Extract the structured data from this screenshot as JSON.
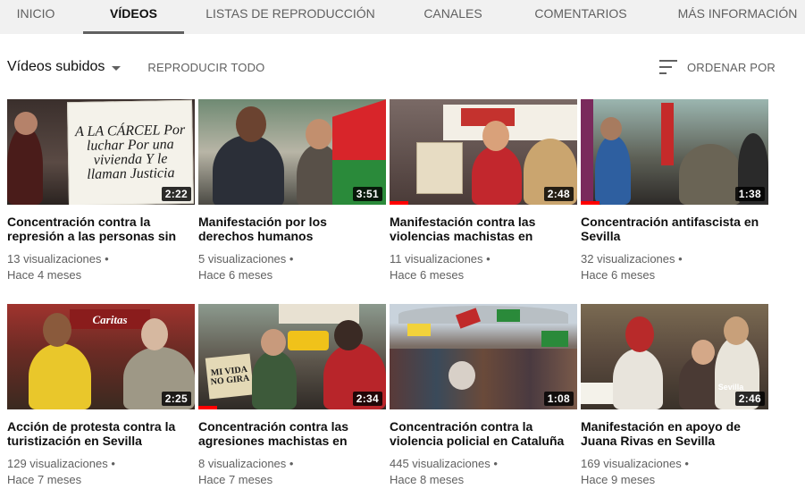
{
  "tabs": [
    {
      "label": "INICIO"
    },
    {
      "label": "VÍDEOS"
    },
    {
      "label": "LISTAS DE REPRODUCCIÓN"
    },
    {
      "label": "CANALES"
    },
    {
      "label": "COMENTARIOS"
    },
    {
      "label": "MÁS INFORMACIÓN"
    }
  ],
  "active_tab": "VÍDEOS",
  "toolbar": {
    "uploads_label": "Vídeos subidos",
    "play_all_label": "REPRODUCIR TODO",
    "sort_label": "ORDENAR POR"
  },
  "videos": [
    {
      "title": "Concentración contra la represión a las personas sin",
      "views": "13 visualizaciones",
      "age": "Hace 4 meses",
      "duration": "2:22",
      "sign_text": "A LA CÁRCEL Por luchar Por una vivienda Y le llaman Justicia",
      "watched": 0
    },
    {
      "title": "Manifestación por los derechos humanos",
      "views": "5 visualizaciones",
      "age": "Hace 6 meses",
      "duration": "3:51",
      "watched": 0
    },
    {
      "title": "Manifestación contra las violencias machistas en",
      "views": "11 visualizaciones",
      "age": "Hace 6 meses",
      "duration": "2:48",
      "watched": 0.1
    },
    {
      "title": "Concentración antifascista en Sevilla",
      "views": "32 visualizaciones",
      "age": "Hace 6 meses",
      "duration": "1:38",
      "watched": 0.1
    },
    {
      "title": "Acción de protesta contra la turistización en Sevilla",
      "views": "129 visualizaciones",
      "age": "Hace 7 meses",
      "duration": "2:25",
      "sign_text": "Caritas",
      "watched": 0
    },
    {
      "title": "Concentración contra las agresiones machistas en",
      "views": "8 visualizaciones",
      "age": "Hace 7 meses",
      "duration": "2:34",
      "sign_text": "MI VIDA NO GIRA",
      "watched": 0.1
    },
    {
      "title": "Concentración contra la violencia policial en Cataluña",
      "views": "445 visualizaciones",
      "age": "Hace 8 meses",
      "duration": "1:08",
      "watched": 0
    },
    {
      "title": "Manifestación en apoyo de Juana Rivas en Sevilla",
      "views": "169 visualizaciones",
      "age": "Hace 9 meses",
      "duration": "2:46",
      "sign_text": "Sevilla",
      "watched": 0
    }
  ],
  "colors": {
    "accent_red": "#ff0000",
    "tab_bg": "#f1f1f1",
    "secondary_text": "#606060"
  }
}
